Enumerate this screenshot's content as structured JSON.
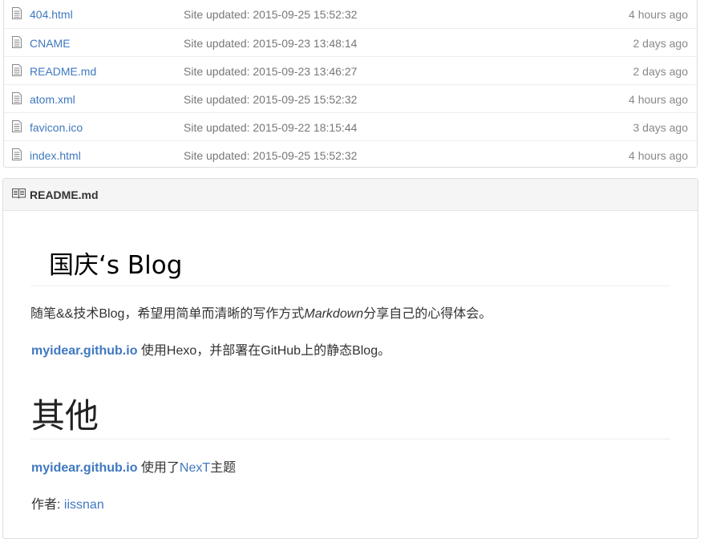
{
  "files": [
    {
      "name": "404.html",
      "message": "Site updated: 2015-09-25 15:52:32",
      "age": "4 hours ago"
    },
    {
      "name": "CNAME",
      "message": "Site updated: 2015-09-23 13:48:14",
      "age": "2 days ago"
    },
    {
      "name": "README.md",
      "message": "Site updated: 2015-09-23 13:46:27",
      "age": "2 days ago"
    },
    {
      "name": "atom.xml",
      "message": "Site updated: 2015-09-25 15:52:32",
      "age": "4 hours ago"
    },
    {
      "name": "favicon.ico",
      "message": "Site updated: 2015-09-22 18:15:44",
      "age": "3 days ago"
    },
    {
      "name": "index.html",
      "message": "Site updated: 2015-09-25 15:52:32",
      "age": "4 hours ago"
    }
  ],
  "readme": {
    "header_title": "README.md",
    "h1": "国庆‘s Blog",
    "p1_before": "随笔&&技术Blog，希望用简单而清晰的写作方式",
    "p1_em": "Markdown",
    "p1_after": "分享自己的心得体会。",
    "p2_link": "myidear.github.io",
    "p2_text": " 使用Hexo，并部署在GitHub上的静态Blog。",
    "h2": "其他",
    "p3_link": "myidear.github.io",
    "p3_text": " 使用了",
    "p3_link2": "NexT",
    "p3_text2": "主题",
    "p4_text": "作者: ",
    "p4_link": "iissnan"
  }
}
